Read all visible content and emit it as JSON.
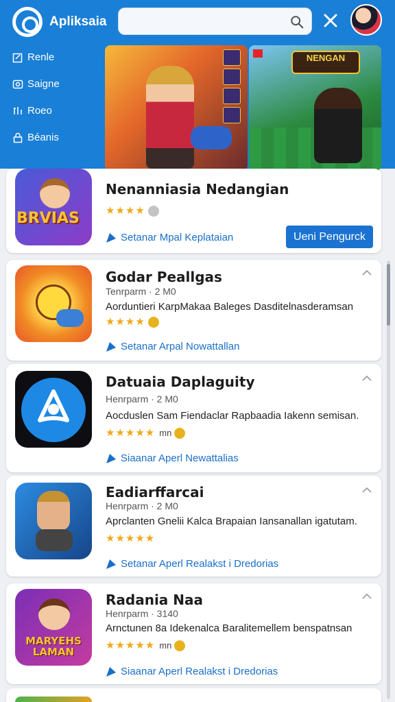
{
  "header": {
    "app_title": "Apliksaia",
    "search_placeholder": "",
    "icons": [
      "logo-icon",
      "search-icon",
      "close-icon",
      "avatar"
    ]
  },
  "sidebar": {
    "items": [
      {
        "label": "Renle",
        "icon": "edit-icon"
      },
      {
        "label": "Saigne",
        "icon": "camera-icon"
      },
      {
        "label": "Roeo",
        "icon": "bars-icon"
      },
      {
        "label": "Béanis",
        "icon": "lock-icon"
      }
    ]
  },
  "banners": {
    "banner2_title": "NENGAN"
  },
  "apps": [
    {
      "name": "Nenanniasia Nedangian",
      "stars": "★★★★",
      "link": "Setanar Mpal Keplataian",
      "button": "Ueni Pengurck",
      "icon_text": "BRVIAS"
    },
    {
      "name": "Godar Peallgas",
      "meta": "Tenrparm · 2 M0",
      "desc": "Aorduntieri KarpMakaa Baleges Dasditelnasderamsan",
      "stars": "★★★★",
      "link": "Setanar Arpal Nowattallan"
    },
    {
      "name": "Datuaia Daplaguity",
      "meta": "Henrparm · 2 M0",
      "desc": "Aocduslen Sam Fiendaclar Rapbaadia Iakenn semisan.",
      "stars": "★★★★★",
      "tag": "mn",
      "link": "Siaanar Aperl Newattalias"
    },
    {
      "name": "Eadiarffarcai",
      "meta": "Henrparm · 2 M0",
      "desc": "Aprclanten Gnelii Kalca Brapaian Iansanallan igatutam.",
      "stars": "★★★★★",
      "link": "Setanar Aperl Realakst i Dredorias"
    },
    {
      "name": "Radania Naa",
      "meta": "Henrparm · 3140",
      "desc": "Arnctunen 8a Idekenalca Baralitemellem benspatnsan",
      "stars": "★★★★★",
      "tag": "mn",
      "link": "Siaanar Aperl Realakst i Dredorias",
      "icon_text": "MARYEHS LAMAN"
    }
  ],
  "colors": {
    "header_bg": "#1a7fd6",
    "accent": "#1a72d1",
    "star": "#f0a81b"
  }
}
